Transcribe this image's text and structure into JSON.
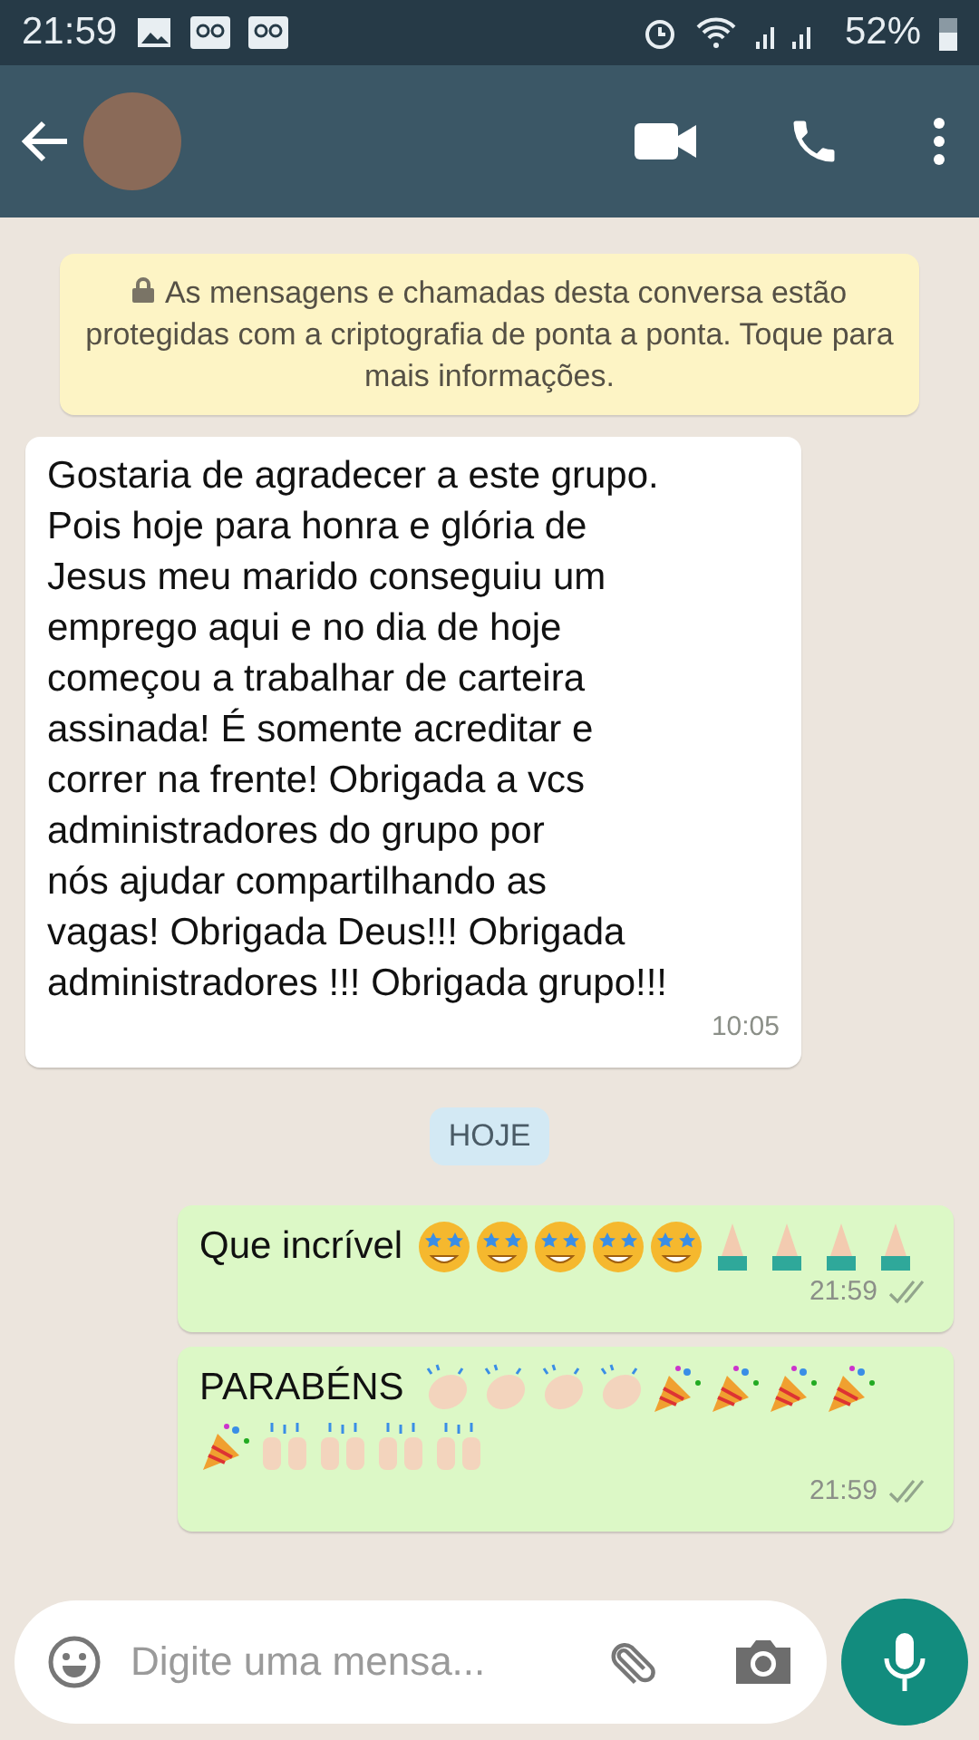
{
  "status_bar": {
    "time": "21:59",
    "battery": "52%"
  },
  "encryption_notice": "As mensagens e chamadas desta conversa estão protegidas com a criptografia de ponta a ponta. Toque para mais informações.",
  "messages": [
    {
      "kind": "text",
      "outgoing": false,
      "lines": [
        "Gostaria de agradecer a este grupo.",
        "Pois hoje para honra e glória de",
        "Jesus meu marido conseguiu um",
        "emprego aqui e no dia de hoje",
        "começou a trabalhar de carteira",
        "assinada! É somente acreditar e",
        "correr na frente! Obrigada a vcs",
        "administradores do grupo por",
        "nós ajudar compartilhando as",
        "vagas! Obrigada Deus!!! Obrigada",
        "administradores !!! Obrigada grupo!!!"
      ],
      "time": "10:05"
    },
    {
      "kind": "date",
      "label": "HOJE"
    },
    {
      "kind": "text",
      "outgoing": true,
      "text": "Que incrível",
      "emojis": [
        {
          "kind": "star"
        },
        {
          "kind": "star"
        },
        {
          "kind": "star"
        },
        {
          "kind": "star"
        },
        {
          "kind": "star"
        },
        {
          "kind": "pray"
        },
        {
          "kind": "pray"
        },
        {
          "kind": "pray"
        },
        {
          "kind": "pray"
        }
      ],
      "time": "21:59",
      "read": false
    },
    {
      "kind": "text",
      "outgoing": true,
      "text": "PARABÉNS",
      "emojis": [
        {
          "kind": "clap"
        },
        {
          "kind": "clap"
        },
        {
          "kind": "clap"
        },
        {
          "kind": "clap"
        },
        {
          "kind": "party"
        },
        {
          "kind": "party"
        },
        {
          "kind": "party"
        },
        {
          "kind": "party"
        },
        {
          "kind": "party"
        },
        {
          "kind": "raise"
        },
        {
          "kind": "raise"
        },
        {
          "kind": "raise"
        },
        {
          "kind": "raise"
        }
      ],
      "time": "21:59",
      "read": false
    }
  ],
  "composer": {
    "placeholder": "Digite uma mensa..."
  }
}
